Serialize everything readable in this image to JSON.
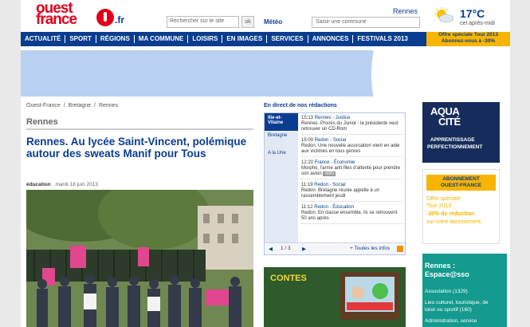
{
  "logo": {
    "line1": "ouest",
    "line2": "france",
    "tld": ".fr"
  },
  "search": {
    "placeholder": "Rechercher sur le site",
    "ok": "ok"
  },
  "meteo": {
    "label": "Météo",
    "city_placeholder": "Saisir une commune",
    "city": "Rennes",
    "temp": "17°C",
    "desc": "cet après-midi"
  },
  "nav": [
    "ACTUALITÉ",
    "SPORT",
    "RÉGIONS",
    "MA COMMUNE",
    "LOISIRS",
    "EN IMAGES",
    "SERVICES",
    "ANNONCES",
    "FESTIVALS 2013"
  ],
  "promo": {
    "line1": "Offre spéciale Tour 2013",
    "line2": "Abonnez-vous à -30%"
  },
  "breadcrumb": [
    "Ouest-France",
    "/",
    "Bretagne",
    "/",
    "Rennes"
  ],
  "section": "Rennes",
  "headline": "Rennes. Au lycée Saint-Vincent, polémique autour des sweats Manif pour Tous",
  "meta": {
    "category": "éducation",
    "date": "mardi 18 juin 2013"
  },
  "live": {
    "title": "En direct de nos rédactions",
    "tabs": [
      "Ille-et-Vilaine",
      "Bretagne",
      "A la Une"
    ],
    "items": [
      {
        "time": "15:13",
        "cat": "Rennes - Justice",
        "text": "Rennes. Procès du Junior : la présidente veut retrouver un CD-Rom"
      },
      {
        "time": "15:00",
        "cat": "Redon - Social",
        "text": "Redon. Une nouvelle association vient en aide aux victimes en tous genres"
      },
      {
        "time": "12:20",
        "cat": "France - Économie",
        "text": "Morpho, l'arme anti files d'attente pour prendre son avion",
        "badge": "vidéo"
      },
      {
        "time": "11:19",
        "cat": "Redon - Social",
        "text": "Redon. Bretagne réunie appelle à un rassemblement jeudi"
      },
      {
        "time": "11:12",
        "cat": "Redon - Éducation",
        "text": "Redon. En classe ensemble, ils se retrouvent 50 ans après"
      }
    ],
    "pager": "1 / 3",
    "all": "+ Toutes les infos"
  },
  "contest": {
    "label": "CONTES"
  },
  "aqua": {
    "l1": "AQUA",
    "l2": "CITÉ",
    "l3": "APPRENTISSAGE",
    "l4": "PERFECTIONNEMENT"
  },
  "abo": {
    "head1": "ABONNEMENT",
    "head2": "OUEST-FRANCE",
    "l1": "Offre spéciale",
    "l2": "Tour 2013",
    "l3": "-30% de réduction",
    "l4": "sur votre abonnement"
  },
  "espace": {
    "title1": "Rennes :",
    "title2": "Espace@sso",
    "lines": [
      "Association (1329)",
      "Lieu culturel, touristique, de",
      "loisir ou sportif (160)",
      "Administration, service"
    ]
  },
  "colors": {
    "brand_red": "#e2001a",
    "brand_blue": "#0a3d8f",
    "promo_yellow": "#f7b500",
    "teal": "#149a8e"
  }
}
